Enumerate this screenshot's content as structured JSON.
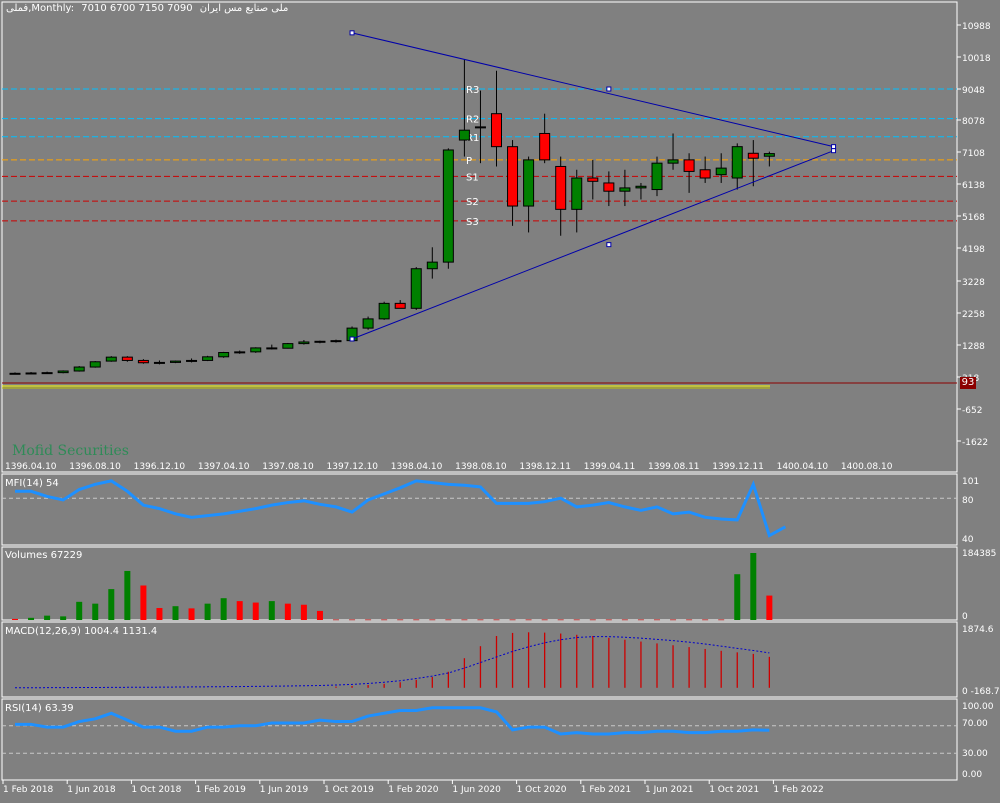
{
  "header": {
    "symbol": "فملی,Monthly:",
    "ohlc": "7010 6700 7150 7090",
    "name": "ملی صنایع مس ایران"
  },
  "watermark": "Mofid Securities",
  "price_badge": "93",
  "colors": {
    "background": "#808080",
    "bull": "#008000",
    "bear": "#ff0000",
    "indicator_line": "#1e90ff",
    "trendline": "#0000aa",
    "pivot_line": "#ffa500",
    "resistance_line": "#00bfff",
    "support_line": "#cc0000",
    "macd_signal": "#0000cc"
  },
  "chart_data": [
    {
      "type": "candlestick",
      "panel": "price",
      "y_ticks": [
        "10988",
        "10018",
        "9048",
        "8078",
        "7108",
        "6138",
        "5168",
        "4198",
        "3228",
        "2258",
        "1288",
        "318",
        "-652",
        "-1622"
      ],
      "x_ticks_top": [
        "1396.04.10",
        "1396.08.10",
        "1396.12.10",
        "1397.04.10",
        "1397.08.10",
        "1397.12.10",
        "1398.04.10",
        "1398.08.10",
        "1398.12.11",
        "1399.04.11",
        "1399.08.11",
        "1399.12.11",
        "1400.04.10",
        "1400.08.10"
      ],
      "x_ticks_bottom": [
        "1 Feb 2018",
        "1 Jun 2018",
        "1 Oct 2018",
        "1 Feb 2019",
        "1 Jun 2019",
        "1 Oct 2019",
        "1 Feb 2020",
        "1 Jun 2020",
        "1 Oct 2020",
        "1 Feb 2021",
        "1 Jun 2021",
        "1 Oct 2021",
        "1 Feb 2022"
      ],
      "ylim": [
        -1622,
        10988
      ],
      "pivot_levels": [
        {
          "label": "R3",
          "value": 9048
        },
        {
          "label": "R2",
          "value": 8150
        },
        {
          "label": "R1",
          "value": 7600
        },
        {
          "label": "P",
          "value": 6900
        },
        {
          "label": "S1",
          "value": 6400
        },
        {
          "label": "S2",
          "value": 5650
        },
        {
          "label": "S3",
          "value": 5050
        }
      ],
      "candles": [
        {
          "o": 420,
          "h": 460,
          "l": 400,
          "c": 430
        },
        {
          "o": 430,
          "h": 470,
          "l": 410,
          "c": 440
        },
        {
          "o": 440,
          "h": 480,
          "l": 420,
          "c": 450
        },
        {
          "o": 450,
          "h": 520,
          "l": 430,
          "c": 500
        },
        {
          "o": 500,
          "h": 650,
          "l": 480,
          "c": 620
        },
        {
          "o": 620,
          "h": 800,
          "l": 600,
          "c": 780
        },
        {
          "o": 800,
          "h": 950,
          "l": 780,
          "c": 920
        },
        {
          "o": 920,
          "h": 950,
          "l": 780,
          "c": 820
        },
        {
          "o": 820,
          "h": 860,
          "l": 720,
          "c": 750
        },
        {
          "o": 750,
          "h": 820,
          "l": 700,
          "c": 760
        },
        {
          "o": 760,
          "h": 820,
          "l": 740,
          "c": 800
        },
        {
          "o": 800,
          "h": 880,
          "l": 760,
          "c": 820
        },
        {
          "o": 820,
          "h": 960,
          "l": 800,
          "c": 930
        },
        {
          "o": 930,
          "h": 1080,
          "l": 900,
          "c": 1060
        },
        {
          "o": 1060,
          "h": 1120,
          "l": 1020,
          "c": 1080
        },
        {
          "o": 1080,
          "h": 1220,
          "l": 1050,
          "c": 1200
        },
        {
          "o": 1200,
          "h": 1300,
          "l": 1150,
          "c": 1190
        },
        {
          "o": 1190,
          "h": 1350,
          "l": 1180,
          "c": 1330
        },
        {
          "o": 1330,
          "h": 1440,
          "l": 1300,
          "c": 1380
        },
        {
          "o": 1380,
          "h": 1420,
          "l": 1340,
          "c": 1400
        },
        {
          "o": 1400,
          "h": 1450,
          "l": 1360,
          "c": 1420
        },
        {
          "o": 1420,
          "h": 1850,
          "l": 1400,
          "c": 1800
        },
        {
          "o": 1800,
          "h": 2150,
          "l": 1750,
          "c": 2080
        },
        {
          "o": 2080,
          "h": 2600,
          "l": 2050,
          "c": 2550
        },
        {
          "o": 2550,
          "h": 2650,
          "l": 2400,
          "c": 2400
        },
        {
          "o": 2400,
          "h": 3650,
          "l": 2350,
          "c": 3600
        },
        {
          "o": 3600,
          "h": 4250,
          "l": 3300,
          "c": 3800
        },
        {
          "o": 3800,
          "h": 7250,
          "l": 3600,
          "c": 7200
        },
        {
          "o": 7500,
          "h": 9950,
          "l": 7000,
          "c": 7800
        },
        {
          "o": 7900,
          "h": 9000,
          "l": 6800,
          "c": 7900
        },
        {
          "o": 8300,
          "h": 9600,
          "l": 6700,
          "c": 7300
        },
        {
          "o": 7300,
          "h": 7500,
          "l": 4900,
          "c": 5500
        },
        {
          "o": 5500,
          "h": 7000,
          "l": 4700,
          "c": 6900
        },
        {
          "o": 7700,
          "h": 8300,
          "l": 6800,
          "c": 6900
        },
        {
          "o": 6700,
          "h": 7000,
          "l": 4600,
          "c": 5400
        },
        {
          "o": 5400,
          "h": 6600,
          "l": 4700,
          "c": 6350
        },
        {
          "o": 6350,
          "h": 6900,
          "l": 5700,
          "c": 6250
        },
        {
          "o": 6200,
          "h": 6550,
          "l": 5500,
          "c": 5950
        },
        {
          "o": 5950,
          "h": 6600,
          "l": 5500,
          "c": 6050
        },
        {
          "o": 6050,
          "h": 6200,
          "l": 5700,
          "c": 6100
        },
        {
          "o": 6000,
          "h": 7000,
          "l": 5800,
          "c": 6800
        },
        {
          "o": 6800,
          "h": 7700,
          "l": 6600,
          "c": 6900
        },
        {
          "o": 6900,
          "h": 7100,
          "l": 5900,
          "c": 6550
        },
        {
          "o": 6600,
          "h": 7000,
          "l": 6200,
          "c": 6350
        },
        {
          "o": 6450,
          "h": 7100,
          "l": 6200,
          "c": 6650
        },
        {
          "o": 6350,
          "h": 7400,
          "l": 6000,
          "c": 7300
        },
        {
          "o": 7100,
          "h": 7500,
          "l": 6100,
          "c": 6950
        },
        {
          "o": 7010,
          "h": 7150,
          "l": 6700,
          "c": 7090
        }
      ],
      "triangle_vertices": {
        "upper_start": {
          "index": 21,
          "value": 10750
        },
        "upper_mid": {
          "index": 37,
          "value": 9048
        },
        "apex": {
          "index": 51,
          "value": 7300
        },
        "lower_start": {
          "index": 21,
          "value": 1470
        },
        "lower_mid": {
          "index": 37,
          "value": 4330
        }
      }
    },
    {
      "type": "line",
      "panel": "MFI",
      "title": "MFI(14) 54",
      "y_ticks": [
        "101",
        "80",
        "40"
      ],
      "ylim": [
        33,
        101
      ],
      "levels": [
        80
      ],
      "values": [
        88,
        88,
        82,
        78,
        90,
        96,
        100,
        88,
        72,
        68,
        62,
        58,
        60,
        62,
        65,
        68,
        72,
        75,
        77,
        73,
        70,
        64,
        78,
        85,
        92,
        100,
        98,
        96,
        95,
        93,
        74,
        74,
        74,
        76,
        80,
        70,
        72,
        75,
        70,
        66,
        70,
        62,
        64,
        58,
        56,
        55,
        96,
        37,
        47
      ]
    },
    {
      "type": "bar",
      "panel": "Volumes",
      "title": "Volumes 67229",
      "y_ticks": [
        "184385",
        "0"
      ],
      "ylim": [
        0,
        184385
      ],
      "bars": [
        {
          "v": 3000,
          "up": false
        },
        {
          "v": 6000,
          "up": true
        },
        {
          "v": 12000,
          "up": true
        },
        {
          "v": 10000,
          "up": true
        },
        {
          "v": 50000,
          "up": true
        },
        {
          "v": 45000,
          "up": true
        },
        {
          "v": 85000,
          "up": true
        },
        {
          "v": 135000,
          "up": true
        },
        {
          "v": 95000,
          "up": false
        },
        {
          "v": 33000,
          "up": false
        },
        {
          "v": 38000,
          "up": true
        },
        {
          "v": 32000,
          "up": false
        },
        {
          "v": 45000,
          "up": true
        },
        {
          "v": 60000,
          "up": true
        },
        {
          "v": 52000,
          "up": false
        },
        {
          "v": 48000,
          "up": false
        },
        {
          "v": 52000,
          "up": true
        },
        {
          "v": 45000,
          "up": false
        },
        {
          "v": 42000,
          "up": false
        },
        {
          "v": 25000,
          "up": false
        },
        {
          "v": 1000,
          "up": false
        },
        {
          "v": 1000,
          "up": false
        },
        {
          "v": 1000,
          "up": false
        },
        {
          "v": 1000,
          "up": false
        },
        {
          "v": 1000,
          "up": false
        },
        {
          "v": 1000,
          "up": false
        },
        {
          "v": 1000,
          "up": false
        },
        {
          "v": 1000,
          "up": false
        },
        {
          "v": 1000,
          "up": false
        },
        {
          "v": 1000,
          "up": false
        },
        {
          "v": 1000,
          "up": false
        },
        {
          "v": 1000,
          "up": false
        },
        {
          "v": 1000,
          "up": false
        },
        {
          "v": 1000,
          "up": false
        },
        {
          "v": 1000,
          "up": false
        },
        {
          "v": 1000,
          "up": false
        },
        {
          "v": 1000,
          "up": false
        },
        {
          "v": 1000,
          "up": false
        },
        {
          "v": 1000,
          "up": false
        },
        {
          "v": 1000,
          "up": false
        },
        {
          "v": 1000,
          "up": false
        },
        {
          "v": 1000,
          "up": false
        },
        {
          "v": 1000,
          "up": false
        },
        {
          "v": 1000,
          "up": false
        },
        {
          "v": 1000,
          "up": false
        },
        {
          "v": 126000,
          "up": true
        },
        {
          "v": 184385,
          "up": true
        },
        {
          "v": 67229,
          "up": false
        }
      ]
    },
    {
      "type": "bar-line",
      "panel": "MACD",
      "title": "MACD(12,26,9) 1004.4 1131.4",
      "y_ticks": [
        "1874.6",
        "0",
        "-168.7"
      ],
      "ylim": [
        -168.7,
        1874.6
      ],
      "hist": [
        0,
        0,
        0,
        0,
        0,
        0,
        0,
        0,
        0,
        0,
        0,
        0,
        0,
        0,
        0,
        0,
        0,
        0,
        0,
        0,
        40,
        60,
        90,
        130,
        180,
        260,
        350,
        520,
        960,
        1350,
        1680,
        1780,
        1800,
        1790,
        1760,
        1720,
        1680,
        1620,
        1560,
        1500,
        1440,
        1380,
        1320,
        1260,
        1200,
        1150,
        1100,
        1004.4
      ],
      "signal": [
        0,
        2,
        4,
        6,
        8,
        10,
        13,
        16,
        18,
        20,
        24,
        28,
        32,
        36,
        40,
        46,
        52,
        58,
        66,
        74,
        90,
        110,
        140,
        180,
        230,
        300,
        380,
        480,
        640,
        820,
        1000,
        1180,
        1330,
        1460,
        1560,
        1630,
        1660,
        1660,
        1640,
        1610,
        1570,
        1530,
        1480,
        1420,
        1350,
        1280,
        1210,
        1131.4
      ]
    },
    {
      "type": "line",
      "panel": "RSI",
      "title": "RSI(14) 63.39",
      "y_ticks": [
        "100.00",
        "70.00",
        "30.00",
        "0.00"
      ],
      "ylim": [
        0,
        100
      ],
      "levels": [
        70,
        30
      ],
      "values": [
        72,
        72,
        68,
        68,
        76,
        80,
        88,
        78,
        68,
        68,
        62,
        62,
        68,
        68,
        70,
        70,
        74,
        74,
        74,
        78,
        76,
        76,
        84,
        88,
        92,
        92,
        96,
        96,
        96,
        96,
        90,
        64,
        68,
        68,
        58,
        60,
        58,
        58,
        60,
        60,
        62,
        62,
        60,
        60,
        62,
        62,
        64,
        63.39
      ]
    }
  ]
}
